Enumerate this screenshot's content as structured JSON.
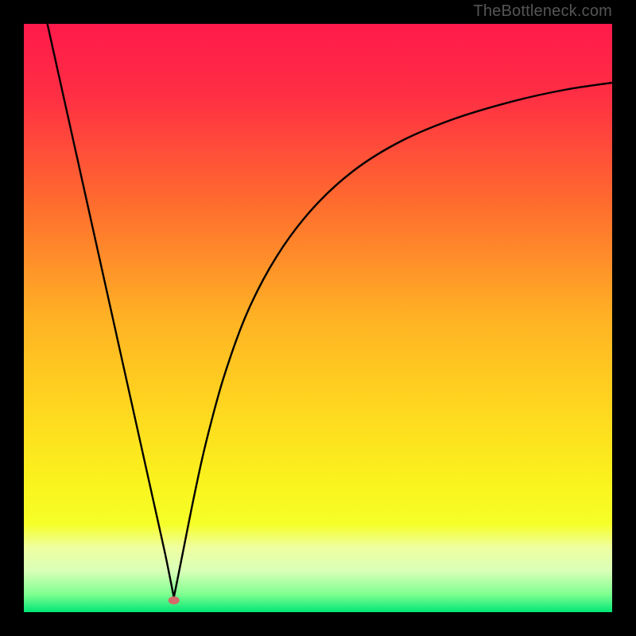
{
  "watermark": "TheBottleneck.com",
  "chart_data": {
    "type": "line",
    "title": "",
    "xlabel": "",
    "ylabel": "",
    "xlim": [
      0,
      100
    ],
    "ylim": [
      0,
      100
    ],
    "gradient_stops": [
      {
        "offset": 0.0,
        "color": "#ff1a4b"
      },
      {
        "offset": 0.12,
        "color": "#ff2e44"
      },
      {
        "offset": 0.3,
        "color": "#ff6a2f"
      },
      {
        "offset": 0.5,
        "color": "#ffb224"
      },
      {
        "offset": 0.65,
        "color": "#ffd61f"
      },
      {
        "offset": 0.78,
        "color": "#faf31e"
      },
      {
        "offset": 0.85,
        "color": "#f6ff28"
      },
      {
        "offset": 0.89,
        "color": "#efffa0"
      },
      {
        "offset": 0.93,
        "color": "#d9ffb8"
      },
      {
        "offset": 0.97,
        "color": "#7eff90"
      },
      {
        "offset": 1.0,
        "color": "#00e676"
      }
    ],
    "series": [
      {
        "name": "left-branch",
        "x": [
          4.0,
          6.0,
          8.0,
          10.0,
          12.0,
          14.0,
          16.0,
          18.0,
          20.0,
          22.0,
          24.0,
          25.5
        ],
        "y": [
          100.0,
          91.0,
          82.0,
          73.0,
          64.0,
          55.0,
          46.0,
          37.0,
          28.0,
          19.0,
          10.0,
          2.5
        ]
      },
      {
        "name": "right-branch",
        "x": [
          25.5,
          27.0,
          29.0,
          31.0,
          34.0,
          38.0,
          43.0,
          49.0,
          56.0,
          64.0,
          73.0,
          83.0,
          92.0,
          100.0
        ],
        "y": [
          2.5,
          10.0,
          20.0,
          29.0,
          40.0,
          51.0,
          60.5,
          68.5,
          75.0,
          80.0,
          83.8,
          86.8,
          88.8,
          90.0
        ]
      }
    ],
    "marker": {
      "x": 25.5,
      "y": 2.0,
      "color": "#d46a6a"
    }
  }
}
